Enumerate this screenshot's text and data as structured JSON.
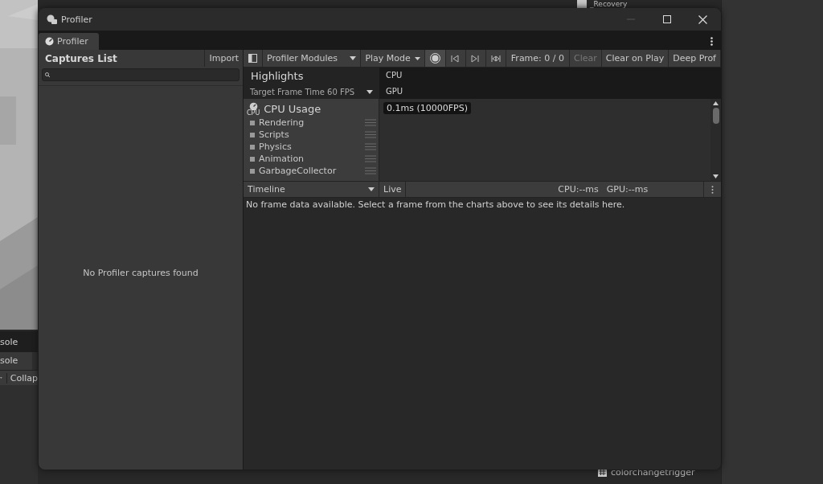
{
  "background": {
    "hierarchy_items": [
      "_Recovery"
    ],
    "console_tabs": [
      "sole",
      "sole"
    ],
    "console_toolbar": [
      "Collap"
    ],
    "project_items": [
      "colorchangetrigger"
    ]
  },
  "window": {
    "title": "Profiler",
    "tab": "Profiler"
  },
  "captures": {
    "title": "Captures List",
    "import_button": "Import",
    "empty_text": "No Profiler captures found"
  },
  "toolbar": {
    "modules_dropdown": "Profiler Modules",
    "play_mode": "Play Mode",
    "recording": false,
    "frame": "Frame: 0 / 0",
    "buttons": [
      {
        "label": "Clear",
        "disabled": true
      },
      {
        "label": "Clear on Play",
        "disabled": false
      },
      {
        "label": "Deep Prof",
        "disabled": false
      }
    ]
  },
  "highlights": {
    "title": "Highlights",
    "target": "Target Frame Time 60 FPS",
    "rows": [
      "CPU",
      "GPU"
    ]
  },
  "module": {
    "title": "CPU Usage",
    "icon_label": "CPU",
    "chart_label": "0.1ms (10000FPS)",
    "legend": [
      {
        "name": "Rendering"
      },
      {
        "name": "Scripts"
      },
      {
        "name": "Physics"
      },
      {
        "name": "Animation"
      },
      {
        "name": "GarbageCollector"
      }
    ]
  },
  "details": {
    "view": "Timeline",
    "live": "Live",
    "cpu": "CPU:--ms",
    "gpu": "GPU:--ms",
    "message": "No frame data available. Select a frame from the charts above to see its details here."
  }
}
